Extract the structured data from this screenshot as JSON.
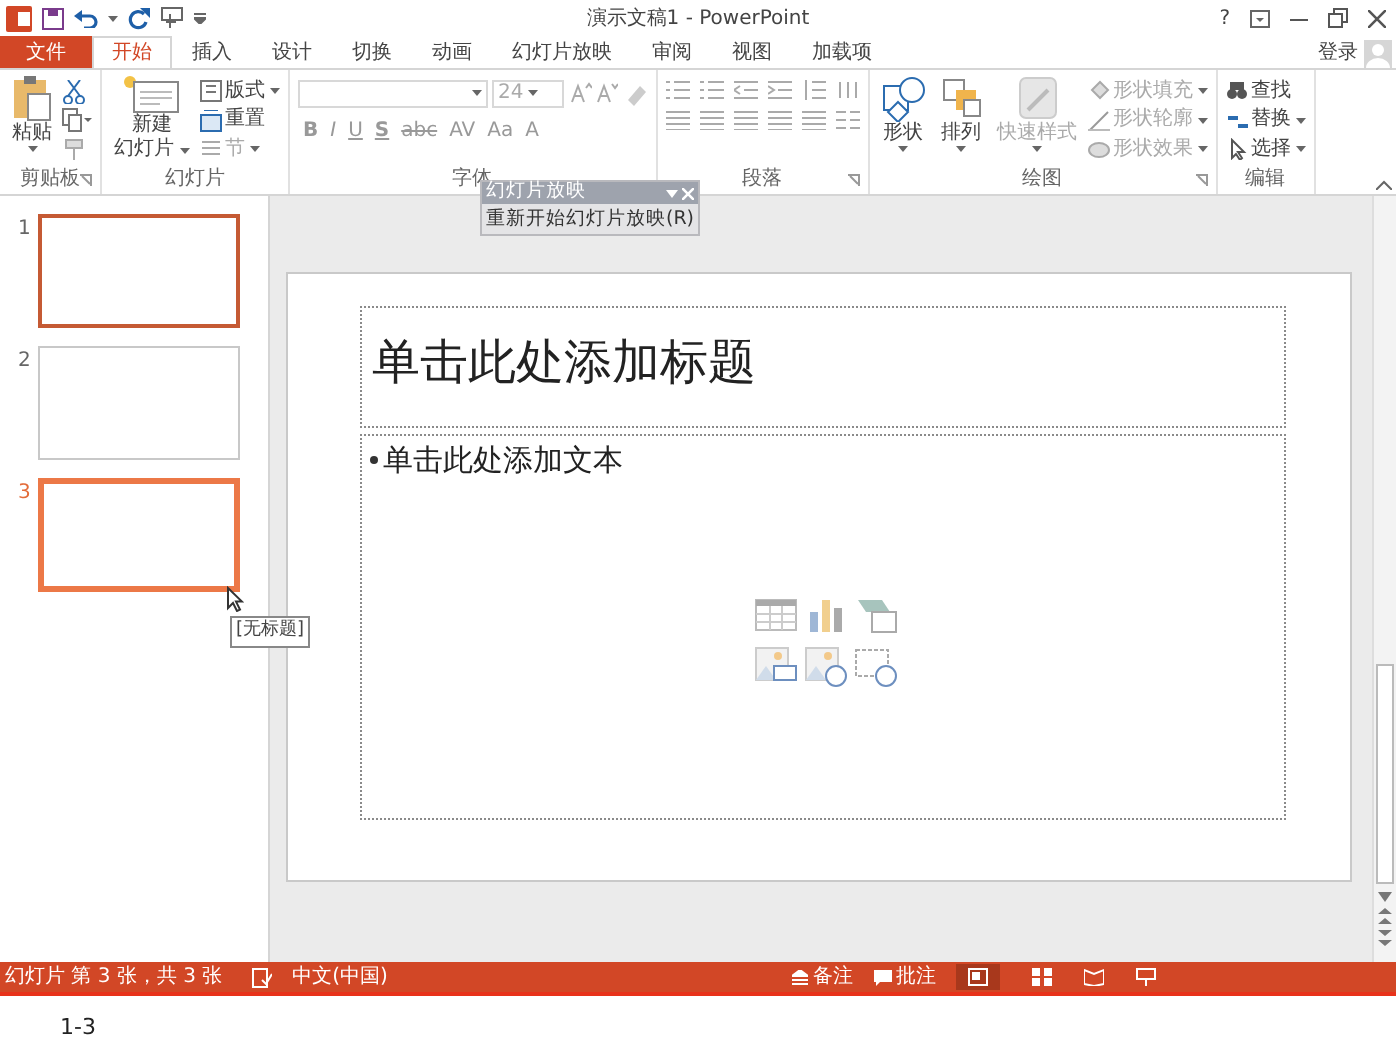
{
  "title_bar": {
    "title": "演示文稿1 - PowerPoint",
    "help": "?"
  },
  "tabs": [
    {
      "label": "文件",
      "kind": "file",
      "selected": false
    },
    {
      "label": "开始",
      "kind": "tab",
      "selected": true
    },
    {
      "label": "插入",
      "kind": "tab",
      "selected": false
    },
    {
      "label": "设计",
      "kind": "tab",
      "selected": false
    },
    {
      "label": "切换",
      "kind": "tab",
      "selected": false
    },
    {
      "label": "动画",
      "kind": "tab",
      "selected": false
    },
    {
      "label": "幻灯片放映",
      "kind": "tab",
      "selected": false
    },
    {
      "label": "审阅",
      "kind": "tab",
      "selected": false
    },
    {
      "label": "视图",
      "kind": "tab",
      "selected": false
    },
    {
      "label": "加载项",
      "kind": "tab",
      "selected": false
    }
  ],
  "account": {
    "sign_in": "登录"
  },
  "ribbon": {
    "groups": [
      {
        "kind": "clipboard",
        "label": "剪贴板",
        "launcher": true,
        "items": [
          {
            "label": "粘贴",
            "disabled": false
          }
        ]
      },
      {
        "kind": "slides",
        "label": "幻灯片",
        "launcher": false,
        "new_slide": [
          "新建",
          "幻灯片"
        ],
        "items": [
          {
            "label": "版式",
            "disabled": false
          },
          {
            "label": "重置",
            "disabled": false
          },
          {
            "label": "节",
            "disabled": true
          }
        ]
      },
      {
        "kind": "font",
        "label": "字体",
        "launcher": false,
        "font_size": "24",
        "format_buttons": [
          "B",
          "I",
          "U",
          "S",
          "abc",
          "AV",
          "Aa",
          "A"
        ]
      },
      {
        "kind": "paragraph",
        "label": "段落",
        "launcher": true
      },
      {
        "kind": "drawing",
        "label": "绘图",
        "launcher": true,
        "items": [
          {
            "label": "形状",
            "disabled": false
          },
          {
            "label": "排列",
            "disabled": false
          },
          {
            "label": "快速样式",
            "disabled": true
          },
          {
            "label": "形状填充",
            "disabled": true
          },
          {
            "label": "形状轮廓",
            "disabled": true
          },
          {
            "label": "形状效果",
            "disabled": true
          }
        ]
      },
      {
        "kind": "editing",
        "label": "编辑",
        "launcher": false,
        "items": [
          {
            "label": "查找",
            "disabled": false
          },
          {
            "label": "替换",
            "disabled": false
          },
          {
            "label": "选择",
            "disabled": false
          }
        ]
      }
    ]
  },
  "slide_panel": {
    "slides": [
      {
        "number": "1",
        "selected": true,
        "hovered": false
      },
      {
        "number": "2",
        "selected": false,
        "hovered": false
      },
      {
        "number": "3",
        "selected": true,
        "hovered": true
      }
    ],
    "tooltip": "[无标题]"
  },
  "slide": {
    "title_placeholder": "单击此处添加标题",
    "body_placeholder": "单击此处添加文本"
  },
  "floating_toolbar": {
    "title": "幻灯片放映",
    "item": "重新开始幻灯片放映(R)"
  },
  "status_bar": {
    "slide_info": "幻灯片 第 3 张，共 3 张",
    "language": "中文(中国)",
    "notes": "备注",
    "comments": "批注"
  },
  "caption": "1-3"
}
